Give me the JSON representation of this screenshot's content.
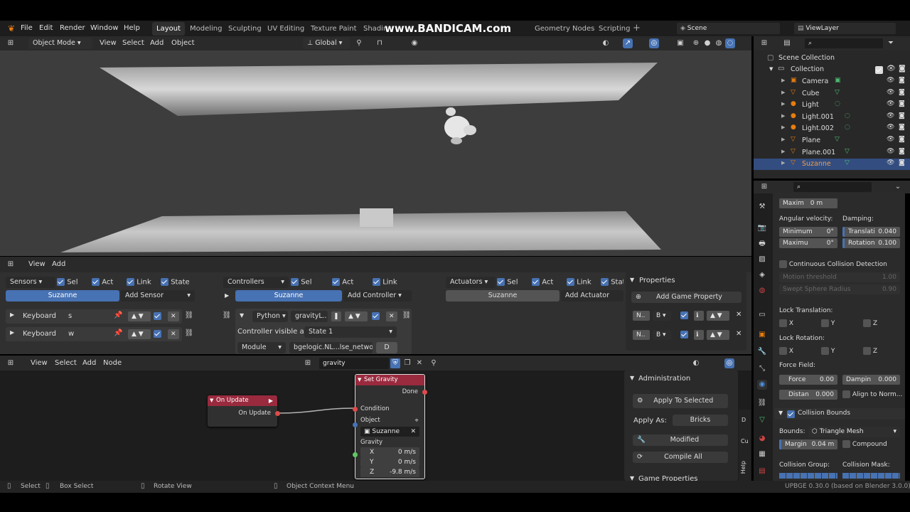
{
  "topbar": {
    "menus": [
      "File",
      "Edit",
      "Render",
      "Window",
      "Help"
    ],
    "workspaces": [
      "Layout",
      "Modeling",
      "Sculpting",
      "UV Editing",
      "Texture Paint",
      "Shading",
      "Geometry Nodes",
      "Scripting"
    ],
    "active_workspace": "Layout",
    "scene": "Scene",
    "view_layer": "ViewLayer",
    "watermark": "www.BANDICAM.com"
  },
  "viewport_header": {
    "mode": "Object Mode",
    "menus": [
      "View",
      "Select",
      "Add",
      "Object"
    ],
    "orientation": "Global"
  },
  "logic_header": {
    "menus": [
      "View",
      "Add"
    ]
  },
  "sensors": {
    "title": "Sensors",
    "flags": [
      "Sel",
      "Act",
      "Link",
      "State"
    ],
    "object": "Suzanne",
    "add": "Add Sensor",
    "items": [
      {
        "type": "Keyboard",
        "key": "s"
      },
      {
        "type": "Keyboard",
        "key": "w"
      }
    ]
  },
  "controllers": {
    "title": "Controllers",
    "flags": [
      "Sel",
      "Act",
      "Link"
    ],
    "object": "Suzanne",
    "add": "Add Controller",
    "python": {
      "type": "Python",
      "name": "gravityL..",
      "visible_label": "Controller visible at:",
      "state": "State 1",
      "mode": "Module",
      "module": "bgelogic.NL...lse_network",
      "d": "D"
    }
  },
  "actuators": {
    "title": "Actuators",
    "flags": [
      "Sel",
      "Act",
      "Link",
      "Stat"
    ],
    "object": "Suzanne",
    "add": "Add Actuator"
  },
  "game_props": {
    "title": "Properties",
    "add": "Add Game Property",
    "rows": [
      {
        "n": "N..",
        "t": "B"
      },
      {
        "n": "N..",
        "t": "B"
      }
    ]
  },
  "node_header": {
    "menus": [
      "View",
      "Select",
      "Add",
      "Node"
    ],
    "tree": "gravity"
  },
  "nodes": {
    "on_update": {
      "title": "On Update",
      "out": "On Update"
    },
    "set_gravity": {
      "title": "Set Gravity",
      "done": "Done",
      "condition": "Condition",
      "object": "Object",
      "object_value": "Suzanne",
      "gravity": "Gravity",
      "x_label": "X",
      "x": "0 m/s",
      "y_label": "Y",
      "y": "0 m/s",
      "z_label": "Z",
      "z": "-9.8 m/s"
    }
  },
  "admin": {
    "title": "Administration",
    "apply_selected": "Apply To Selected",
    "apply_as": "Apply As:",
    "apply_as_val": "Bricks",
    "modified": "Modified",
    "compile": "Compile All",
    "game_props": "Game Properties"
  },
  "side_tabs": [
    "Cu",
    "Help"
  ],
  "outliner": {
    "root": "Scene Collection",
    "collection": "Collection",
    "items": [
      {
        "name": "Camera",
        "kind": "camera"
      },
      {
        "name": "Cube",
        "kind": "mesh"
      },
      {
        "name": "Light",
        "kind": "light"
      },
      {
        "name": "Light.001",
        "kind": "light"
      },
      {
        "name": "Light.002",
        "kind": "light"
      },
      {
        "name": "Plane",
        "kind": "mesh"
      },
      {
        "name": "Plane.001",
        "kind": "mesh"
      },
      {
        "name": "Suzanne",
        "kind": "mesh",
        "selected": true
      }
    ]
  },
  "physics": {
    "maxim_label": "Maxim",
    "maxim_val": "0 m",
    "angular": "Angular velocity:",
    "damping": "Damping:",
    "min_label": "Minimum",
    "min_val": "0°",
    "max_label": "Maximu",
    "max_val": "0°",
    "transl_label": "Translati",
    "transl_val": "0.040",
    "rot_label": "Rotation",
    "rot_val": "0.100",
    "ccd": "Continuous Collision Detection",
    "motion": "Motion threshold",
    "motion_val": "1.00",
    "swept": "Swept Sphere Radius",
    "swept_val": "0.90",
    "lock_t": "Lock Translation:",
    "lock_r": "Lock Rotation:",
    "x": "X",
    "y": "Y",
    "z": "Z",
    "force_field": "Force Field:",
    "force_label": "Force",
    "force_val": "0.00",
    "dampin_label": "Dampin",
    "dampin_val": "0.000",
    "distan_label": "Distan",
    "distan_val": "0.000",
    "align": "Align to Norm...",
    "collision_bounds": "Collision Bounds",
    "bounds_label": "Bounds:",
    "bounds_val": "Triangle Mesh",
    "margin_label": "Margin",
    "margin_val": "0.04 m",
    "compound": "Compound",
    "coll_group": "Collision Group:",
    "coll_mask": "Collision Mask:"
  },
  "statusbar": {
    "select": "Select",
    "box_select": "Box Select",
    "rotate": "Rotate View",
    "context": "Object Context Menu",
    "version": "UPBGE 0.30.0 (based on Blender 3.0.0)"
  },
  "colors": {
    "accent": "#4772b3",
    "node_header": "#9a2a3e",
    "selected_row": "#334d80"
  }
}
